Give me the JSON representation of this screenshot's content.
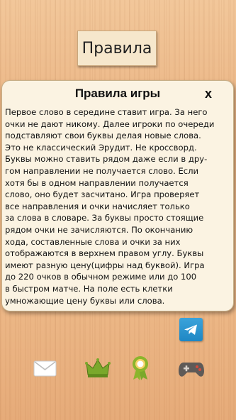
{
  "top_button": {
    "label": "Правила"
  },
  "dialog": {
    "title": "Правила игры",
    "close_label": "x",
    "lines": [
      "Первое слово в середине ставит игра. За него",
      "очки не дают никому. Далее игроки по очереди",
      "подставляют свои буквы делая новые слова.",
      "Это не классический Эрудит. Не кроссворд.",
      "Буквы можно ставить рядом даже если в дру-",
      "гом направлении не получается слово. Если",
      "хотя бы в одном направлении получается",
      "слово, оно будет засчитано. Игра проверяет",
      "все направления и очки начисляет только",
      "за слова в словаре. За буквы просто стоящие",
      "рядом очки не зачисляются. По окончанию",
      "хода, составленные слова и очки за них",
      "отображаются в верхнем правом углу. Буквы",
      "имеют разную цену(цифры над буквой). Игра",
      "до 220 очков в обычном режиме или до 100",
      "в быстром матче. На поле есть клетки",
      "умножающие цену буквы или слова."
    ]
  },
  "bottom_icons": [
    "telegram-icon",
    "mail-icon",
    "crown-icon",
    "award-icon",
    "gamepad-icon"
  ],
  "colors": {
    "background": "#ecb585",
    "dialog": "#fbf3e2",
    "crown": "#7aa82b",
    "telegram": "#2a96d1"
  }
}
